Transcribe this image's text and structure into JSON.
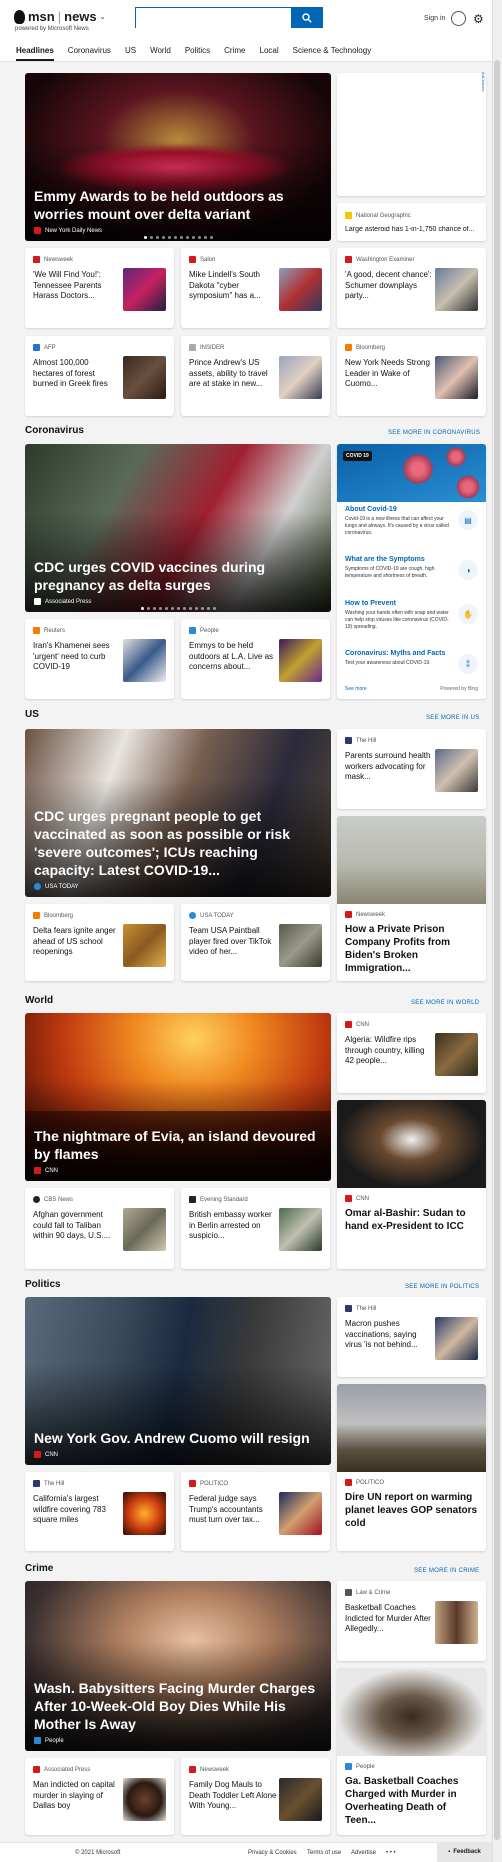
{
  "header": {
    "logo_msn": "msn",
    "logo_sep": "|",
    "logo_news": "news",
    "powered_by": "powered by Microsoft News",
    "search_placeholder": "",
    "sign_in": "Sign in",
    "tabs": [
      "Headlines",
      "Coronavirus",
      "US",
      "World",
      "Politics",
      "Crime",
      "Local",
      "Science & Technology"
    ],
    "active_tab": "Headlines"
  },
  "ad_label": "AdChoices",
  "headlines": {
    "hero": {
      "title": "Emmy Awards to be held outdoors as worries mount over delta variant",
      "source": "New York Daily News"
    },
    "side_card": {
      "source": "National Geographic",
      "title": "Large asteroid has 1-in-1,750 chance of..."
    },
    "row1": [
      {
        "source": "Newsweek",
        "title": "'We Will Find You!': Tennessee Parents Harass Doctors..."
      },
      {
        "source": "Salon",
        "title": "Mike Lindell's South Dakota \"cyber symposium\" has a..."
      },
      {
        "source": "Washington Examiner",
        "title": "'A good, decent chance': Schumer downplays party..."
      }
    ],
    "row2": [
      {
        "source": "AFP",
        "title": "Almost 100,000 hectares of forest burned in Greek fires"
      },
      {
        "source": "INSIDER",
        "title": "Prince Andrew's US assets, ability to travel are at stake in new..."
      },
      {
        "source": "Bloomberg",
        "title": "New York Needs Strong Leader in Wake of Cuomo..."
      }
    ]
  },
  "coronavirus": {
    "heading": "Coronavirus",
    "see_more": "SEE MORE IN CORONAVIRUS",
    "hero": {
      "title": "CDC urges COVID vaccines during pregnancy as delta surges",
      "source": "Associated Press"
    },
    "info": {
      "badge": "COVID 19",
      "items": [
        {
          "title": "About Covid-19",
          "desc": "Covid-19 is a new illness that can affect your lungs and airways. It's caused by a virus called coronavirus."
        },
        {
          "title": "What are the Symptoms",
          "desc": "Symptoms of COVID-19 are cough, high temperature and shortness of breath."
        },
        {
          "title": "How to Prevent",
          "desc": "Washing your hands often with soap and water can help stop viruses like coronavirus (COVID-19) spreading."
        },
        {
          "title": "Coronavirus: Myths and Facts",
          "desc": "Test your awareness about COVID-19."
        }
      ],
      "see_more": "See more",
      "powered": "Powered by Bing"
    },
    "row": [
      {
        "source": "Reuters",
        "title": "Iran's Khamenei sees 'urgent' need to curb COVID-19"
      },
      {
        "source": "People",
        "title": "Emmys to be held outdoors at L.A. Live as concerns about..."
      }
    ]
  },
  "us": {
    "heading": "US",
    "see_more": "SEE MORE IN US",
    "hero": {
      "title": "CDC urges pregnant people to get vaccinated as soon as possible or risk 'severe outcomes'; ICUs reaching capacity: Latest COVID-19...",
      "source": "USA TODAY"
    },
    "side_small": {
      "source": "The Hill",
      "title": "Parents surround health workers advocating for mask..."
    },
    "side_tall": {
      "source": "Newsweek",
      "title": "How a Private Prison Company Profits from Biden's Broken Immigration..."
    },
    "row": [
      {
        "source": "Bloomberg",
        "title": "Delta fears ignite anger ahead of US school reopenings"
      },
      {
        "source": "USA TODAY",
        "title": "Team USA Paintball player fired over TikTok video of her..."
      }
    ]
  },
  "world": {
    "heading": "World",
    "see_more": "SEE MORE IN WORLD",
    "hero": {
      "title": "The nightmare of Evia, an island devoured by flames",
      "source": "CNN"
    },
    "side_small": {
      "source": "CNN",
      "title": "Algeria: Wildfire rips through country, killing 42 people..."
    },
    "side_tall": {
      "source": "CNN",
      "title": "Omar al-Bashir: Sudan to hand ex-President to ICC"
    },
    "row": [
      {
        "source": "CBS News",
        "title": "Afghan government could fall to Taliban within 90 days, U.S...."
      },
      {
        "source": "Evening Standard",
        "title": "British embassy worker in Berlin arrested on suspicio..."
      }
    ]
  },
  "politics": {
    "heading": "Politics",
    "see_more": "SEE MORE IN POLITICS",
    "hero": {
      "title": "New York Gov. Andrew Cuomo will resign",
      "source": "CNN"
    },
    "side_small": {
      "source": "The Hill",
      "title": "Macron pushes vaccinations, saying virus 'is not behind..."
    },
    "side_tall": {
      "source": "POLITICO",
      "title": "Dire UN report on warming planet leaves GOP senators cold"
    },
    "row": [
      {
        "source": "The Hill",
        "title": "California's largest wildfire covering 783 square miles"
      },
      {
        "source": "POLITICO",
        "title": "Federal judge says Trump's accountants must turn over tax..."
      }
    ]
  },
  "crime": {
    "heading": "Crime",
    "see_more": "SEE MORE IN CRIME",
    "hero": {
      "title": "Wash. Babysitters Facing Murder Charges After 10-Week-Old Boy Dies While His Mother Is Away",
      "source": "People"
    },
    "side_small": {
      "source": "Law & Crime",
      "title": "Basketball Coaches Indicted for Murder After Allegedly..."
    },
    "side_tall": {
      "source": "People",
      "title": "Ga. Basketball Coaches Charged with Murder in Overheating Death of Teen..."
    },
    "row": [
      {
        "source": "Associated Press",
        "title": "Man indicted on capital murder in slaying of Dallas boy"
      },
      {
        "source": "Newsweek",
        "title": "Family Dog Mauls to Death Toddler Left Alone With Young..."
      }
    ]
  },
  "footer": {
    "copyright": "© 2021 Microsoft",
    "privacy": "Privacy & Cookies",
    "terms": "Terms of use",
    "advertise": "Advertise",
    "more": "• • •",
    "feedback": "Feedback"
  }
}
